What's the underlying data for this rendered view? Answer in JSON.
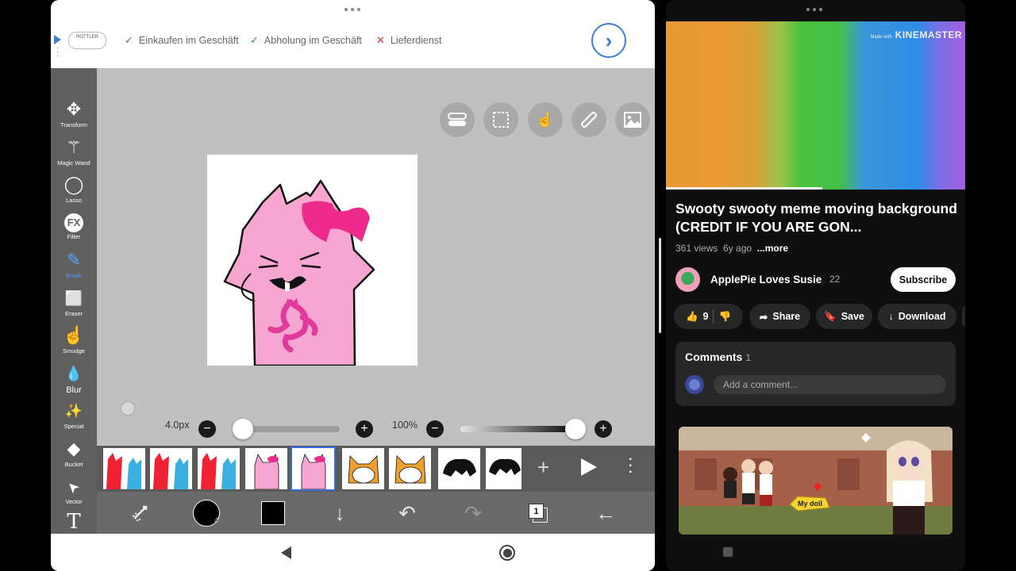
{
  "ad": {
    "logo": "ROTTLER",
    "items": [
      {
        "mark": "✓",
        "text": "Einkaufen im Geschäft",
        "ok": true
      },
      {
        "mark": "✓",
        "text": "Abholung im Geschäft",
        "ok": true
      },
      {
        "mark": "✕",
        "text": "Lieferdienst",
        "ok": false
      }
    ]
  },
  "tools": [
    {
      "label": "Transform",
      "icon": "move-icon",
      "glyph": "✥"
    },
    {
      "label": "Magic Wand",
      "icon": "magic-wand-icon",
      "glyph": "⚚"
    },
    {
      "label": "Lasso",
      "icon": "lasso-icon",
      "glyph": "◯"
    },
    {
      "label": "Filter",
      "icon": "fx-icon",
      "glyph": "FX"
    },
    {
      "label": "Brush",
      "icon": "brush-icon",
      "glyph": "✎"
    },
    {
      "label": "Eraser",
      "icon": "eraser-icon",
      "glyph": "⬜"
    },
    {
      "label": "Smudge",
      "icon": "smudge-icon",
      "glyph": "☝"
    },
    {
      "label": "Blur",
      "icon": "drop-icon",
      "glyph": "💧"
    },
    {
      "label": "Special",
      "icon": "sparkle-wand-icon",
      "glyph": "✨"
    },
    {
      "label": "Bucket",
      "icon": "bucket-icon",
      "glyph": "◆"
    },
    {
      "label": "Vector",
      "icon": "cursor-icon",
      "glyph": "➤"
    },
    {
      "label": "",
      "icon": "text-icon",
      "glyph": "T"
    }
  ],
  "active_tool": "Brush",
  "brush": {
    "size_label": "4.0px",
    "opacity_label": "100%",
    "size_level": 0.05,
    "opacity_level": 1.0
  },
  "layer_count": "1",
  "colors": {
    "accent": "#5aa0ff",
    "pink": "#f6a6d0",
    "bow": "#ee2b8c",
    "youtube_bg": "#0f0f0f"
  },
  "video": {
    "watermark_small": "Made with",
    "watermark": "KINEMASTER",
    "title": "Swooty swooty meme moving background (CREDIT IF YOU ARE GON...",
    "views": "361 views",
    "age": "6y ago",
    "more": "...more",
    "channel": "AppIePie Loves Susie",
    "subs": "22",
    "subscribe": "Subscribe",
    "likes": "9",
    "share": "Share",
    "save": "Save",
    "download": "Download"
  },
  "comments": {
    "title": "Comments",
    "count": "1",
    "placeholder": "Add a comment..."
  },
  "thumb_caption": "My doll"
}
